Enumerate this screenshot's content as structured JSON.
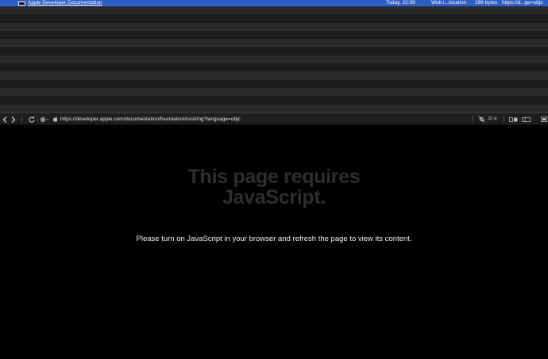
{
  "history": {
    "selected": {
      "title": "Apple Developer Documentation",
      "time": "Today, 22:39",
      "kind": "Web i...location",
      "size": "298 bytes",
      "url": "https://d...ge=objc"
    },
    "empty_row_count": 13
  },
  "toolbar": {
    "url": "https://developer.apple.com/documentation/foundation/nsstring?language=objc",
    "counter": "22 w"
  },
  "content": {
    "heading_line1": "This page requires",
    "heading_line2": "JavaScript.",
    "message": "Please turn on JavaScript in your browser and refresh the page to view its content."
  },
  "colors": {
    "selection": "#2f5fc6",
    "heading": "#2e2e2e",
    "background": "#000000"
  }
}
